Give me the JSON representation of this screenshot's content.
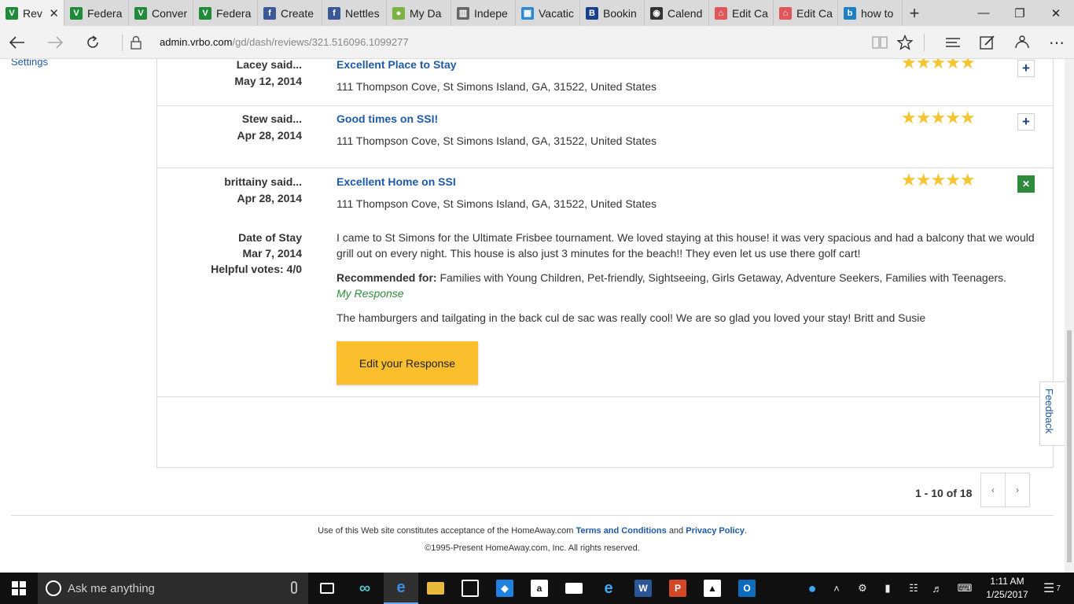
{
  "browser": {
    "tabs": [
      {
        "label": "Rev",
        "icon": "vrbo-icon",
        "color": "#1f8b3a",
        "glyph": "V",
        "active": true
      },
      {
        "label": "Federa",
        "icon": "vrbo-icon",
        "color": "#1f8b3a",
        "glyph": "V"
      },
      {
        "label": "Conver",
        "icon": "vrbo-icon",
        "color": "#1f8b3a",
        "glyph": "V"
      },
      {
        "label": "Federa",
        "icon": "vrbo-icon",
        "color": "#1f8b3a",
        "glyph": "V"
      },
      {
        "label": "Create",
        "icon": "facebook-icon",
        "color": "#3b5998",
        "glyph": "f"
      },
      {
        "label": "Nettles",
        "icon": "facebook-icon",
        "color": "#3b5998",
        "glyph": "f"
      },
      {
        "label": "My Da",
        "icon": "map-pin-icon",
        "color": "#7cb342",
        "glyph": "●"
      },
      {
        "label": "Indepe",
        "icon": "bank-icon",
        "color": "#666666",
        "glyph": "▥"
      },
      {
        "label": "Vacatic",
        "icon": "homeaway-icon",
        "color": "#2b8ad3",
        "glyph": "▦"
      },
      {
        "label": "Bookin",
        "icon": "booking-icon",
        "color": "#1b3d8f",
        "glyph": "B"
      },
      {
        "label": "Calend",
        "icon": "tripadvisor-icon",
        "color": "#333333",
        "glyph": "◉"
      },
      {
        "label": "Edit Ca",
        "icon": "airbnb-icon",
        "color": "#e0565b",
        "glyph": "⌂"
      },
      {
        "label": "Edit Ca",
        "icon": "airbnb-icon",
        "color": "#e0565b",
        "glyph": "⌂"
      },
      {
        "label": "how to",
        "icon": "bing-icon",
        "color": "#1e7fc2",
        "glyph": "b"
      }
    ],
    "url_host": "admin.vrbo.com",
    "url_path": "/gd/dash/reviews/321.516096.1099277"
  },
  "sidebar": {
    "settings_label": "Settings"
  },
  "reviews": [
    {
      "author": "Lacey said...",
      "date": "May 12, 2014",
      "title": "Excellent Place to Stay",
      "address": "111 Thompson Cove, St Simons Island, GA, 31522, United States",
      "rating": 5,
      "expanded": false
    },
    {
      "author": "Stew said...",
      "date": "Apr 28, 2014",
      "title": "Good times on SSI!",
      "address": "111 Thompson Cove, St Simons Island, GA, 31522, United States",
      "rating": 5,
      "expanded": false
    },
    {
      "author": "brittainy said...",
      "date": "Apr 28, 2014",
      "title": "Excellent Home on SSI",
      "address": "111 Thompson Cove, St Simons Island, GA, 31522, United States",
      "rating": 5,
      "expanded": true,
      "date_of_stay_label": "Date of Stay",
      "date_of_stay": "Mar 7, 2014",
      "helpful_votes": "Helpful votes: 4/0",
      "body": "I came to St Simons for the Ultimate Frisbee tournament. We loved staying at this house! it was very spacious and had a balcony that we would grill out on every night. This house is also just 3 minutes for the beach!! They even let us use there golf cart!",
      "recommended_label": "Recommended for:",
      "recommended_for": "Families with Young Children, Pet-friendly, Sightseeing, Girls Getaway, Adventure Seekers, Families with Teenagers.",
      "my_response_label": "My Response",
      "response": "The hamburgers and tailgating in the back cul de sac was really cool! We are so glad you loved your stay! Britt and Susie",
      "edit_button": "Edit your Response"
    }
  ],
  "pagination": {
    "summary": "1 - 10 of 18",
    "prev": "‹",
    "next": "›"
  },
  "feedback_label": "Feedback",
  "footer": {
    "line1_prefix": "Use of this Web site constitutes acceptance of the HomeAway.com",
    "terms": "Terms and Conditions",
    "and": "and",
    "privacy": "Privacy Policy",
    "period": ".",
    "line2": "©1995-Present HomeAway.com, Inc. All rights reserved."
  },
  "taskbar": {
    "search_placeholder": "Ask me anything",
    "time": "1:11 AM",
    "date": "1/25/2017",
    "notification_count": "7"
  },
  "colors": {
    "link": "#1e5aa6",
    "star": "#f5c431",
    "button": "#fbbf2d",
    "response_green": "#2f8a3b"
  }
}
